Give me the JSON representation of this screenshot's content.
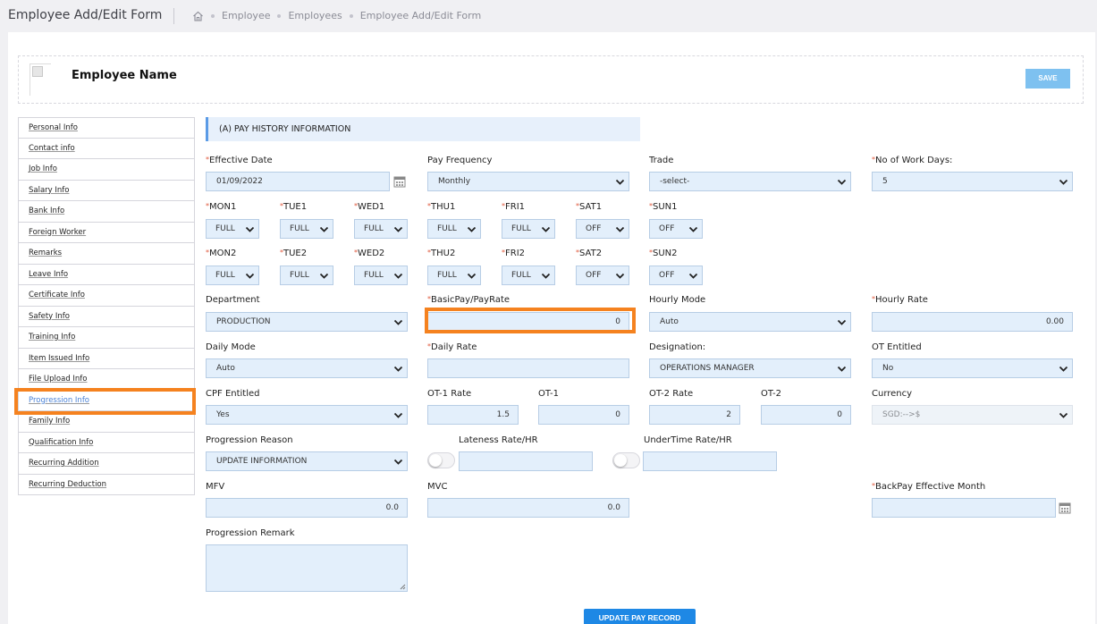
{
  "header": {
    "title": "Employee Add/Edit Form",
    "breadcrumb": [
      "Employee",
      "Employees",
      "Employee Add/Edit Form"
    ]
  },
  "profile": {
    "name": "Employee Name",
    "save_label": "SAVE"
  },
  "sidebar": {
    "items": [
      {
        "label": "Personal Info"
      },
      {
        "label": "Contact info"
      },
      {
        "label": "Job Info"
      },
      {
        "label": "Salary Info"
      },
      {
        "label": "Bank Info"
      },
      {
        "label": "Foreign Worker"
      },
      {
        "label": "Remarks"
      },
      {
        "label": "Leave Info"
      },
      {
        "label": "Certificate Info"
      },
      {
        "label": "Safety Info"
      },
      {
        "label": "Training Info"
      },
      {
        "label": "Item Issued Info"
      },
      {
        "label": "File Upload Info"
      },
      {
        "label": "Progression Info"
      },
      {
        "label": "Family Info"
      },
      {
        "label": "Qualification Info"
      },
      {
        "label": "Recurring Addition"
      },
      {
        "label": "Recurring Deduction"
      }
    ],
    "active_index": 13
  },
  "section": {
    "title": "(A) PAY HISTORY INFORMATION"
  },
  "form": {
    "effective_date": {
      "label": "Effective Date",
      "value": "01/09/2022"
    },
    "pay_frequency": {
      "label": "Pay Frequency",
      "value": "Monthly"
    },
    "trade": {
      "label": "Trade",
      "value": "-select-"
    },
    "work_days": {
      "label": "No of Work Days:",
      "value": "5"
    },
    "week1": [
      {
        "label": "MON1",
        "value": "FULL"
      },
      {
        "label": "TUE1",
        "value": "FULL"
      },
      {
        "label": "WED1",
        "value": "FULL"
      },
      {
        "label": "THU1",
        "value": "FULL"
      },
      {
        "label": "FRI1",
        "value": "FULL"
      },
      {
        "label": "SAT1",
        "value": "OFF"
      },
      {
        "label": "SUN1",
        "value": "OFF"
      }
    ],
    "week2": [
      {
        "label": "MON2",
        "value": "FULL"
      },
      {
        "label": "TUE2",
        "value": "FULL"
      },
      {
        "label": "WED2",
        "value": "FULL"
      },
      {
        "label": "THU2",
        "value": "FULL"
      },
      {
        "label": "FRI2",
        "value": "FULL"
      },
      {
        "label": "SAT2",
        "value": "OFF"
      },
      {
        "label": "SUN2",
        "value": "OFF"
      }
    ],
    "department": {
      "label": "Department",
      "value": "PRODUCTION"
    },
    "basic_pay": {
      "label": "BasicPay/PayRate",
      "value": "0"
    },
    "hourly_mode": {
      "label": "Hourly Mode",
      "value": "Auto"
    },
    "hourly_rate": {
      "label": "Hourly Rate",
      "value": "0.00"
    },
    "daily_mode": {
      "label": "Daily Mode",
      "value": "Auto"
    },
    "daily_rate": {
      "label": "Daily Rate",
      "value": ""
    },
    "designation": {
      "label": "Designation:",
      "value": "OPERATIONS MANAGER"
    },
    "ot_entitled": {
      "label": "OT Entitled",
      "value": "No"
    },
    "cpf_entitled": {
      "label": "CPF Entitled",
      "value": "Yes"
    },
    "ot1_rate": {
      "label": "OT-1 Rate",
      "value": "1.5"
    },
    "ot1": {
      "label": "OT-1",
      "value": "0"
    },
    "ot2_rate": {
      "label": "OT-2 Rate",
      "value": "2"
    },
    "ot2": {
      "label": "OT-2",
      "value": "0"
    },
    "currency": {
      "label": "Currency",
      "value": "SGD:-->$"
    },
    "progression_reason": {
      "label": "Progression Reason",
      "value": "UPDATE INFORMATION"
    },
    "lateness_rate": {
      "label": "Lateness Rate/HR",
      "value": ""
    },
    "undertime_rate": {
      "label": "UnderTime Rate/HR",
      "value": ""
    },
    "mfv": {
      "label": "MFV",
      "value": "0.0"
    },
    "mvc": {
      "label": "MVC",
      "value": "0.0"
    },
    "backpay_month": {
      "label": "BackPay Effective Month",
      "value": ""
    },
    "progression_remark": {
      "label": "Progression Remark",
      "value": ""
    }
  },
  "update_label": "UPDATE PAY RECORD",
  "colors": {
    "accent": "#1e88e5",
    "highlight": "#f5821f",
    "field_bg": "#e3effb"
  }
}
